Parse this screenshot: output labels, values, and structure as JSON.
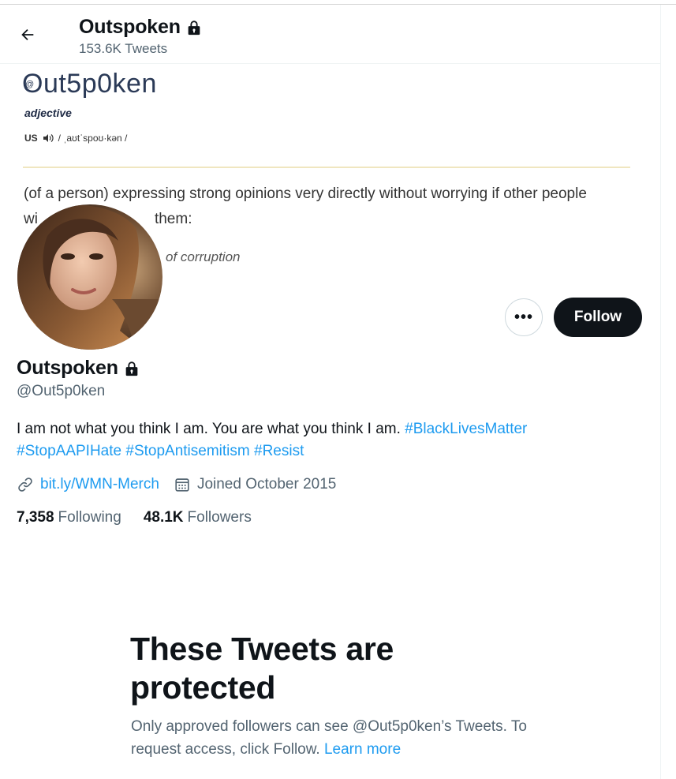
{
  "header": {
    "name": "Outspoken",
    "tweet_count": "153.6K Tweets"
  },
  "banner": {
    "word_at": "@",
    "word": "Out5p0ken",
    "part_of_speech": "adjective",
    "region": "US",
    "pronunciation": "/ ˌaʊtˈspoʊ·kən /",
    "definition_line1": "(of a person) expressing strong opinions very directly without worrying if other people",
    "definition_line2": "wi",
    "definition_line2_end": "them:",
    "example": "of corruption"
  },
  "actions": {
    "more_label": "•••",
    "follow_label": "Follow"
  },
  "profile": {
    "name": "Outspoken",
    "handle": "@Out5p0ken",
    "bio_text": "I am not what you think I am. You are what you think I am. ",
    "hashtags": [
      "#BlackLivesMatter",
      "#StopAAPIHate",
      "#StopAntisemitism",
      "#Resist"
    ],
    "link": "bit.ly/WMN-Merch",
    "joined": "Joined October 2015",
    "following_count": "7,358",
    "following_label": "Following",
    "followers_count": "48.1K",
    "followers_label": "Followers"
  },
  "protected": {
    "title": "These Tweets are protected",
    "subtitle": "Only approved followers can see @Out5p0ken’s Tweets. To request access, click Follow.",
    "learn_more": "Learn more"
  },
  "colors": {
    "accent": "#1d9bf0",
    "text_primary": "#0f1419",
    "text_secondary": "#536471",
    "follow_bg": "#0f1419"
  },
  "icons": {
    "back": "arrow-left-icon",
    "lock": "lock-icon",
    "link": "link-icon",
    "calendar": "calendar-icon",
    "speaker": "speaker-icon"
  }
}
